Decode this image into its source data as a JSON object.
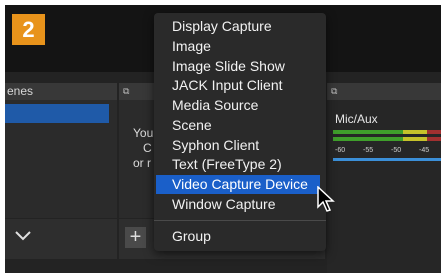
{
  "step_badge": "2",
  "scenes_panel": {
    "title": "enes",
    "footer_icon": "chevron-down-icon"
  },
  "sources_panel": {
    "dock_icon": "dock-icon",
    "message_lines": [
      "You",
      "C",
      "or r"
    ],
    "add_icon": "plus-icon"
  },
  "mixer_panel": {
    "dock_icon": "dock-icon",
    "channel_label": "Mic/Aux",
    "scale_labels": [
      "-60",
      "-55",
      "-50",
      "-45"
    ]
  },
  "context_menu": {
    "items": [
      "Display Capture",
      "Image",
      "Image Slide Show",
      "JACK Input Client",
      "Media Source",
      "Scene",
      "Syphon Client",
      "Text (FreeType 2)",
      "Video Capture Device",
      "Window Capture"
    ],
    "selected": "Video Capture Device",
    "group_label": "Group"
  },
  "colors": {
    "accent": "#e8931b",
    "selection": "#1a5fc9",
    "scene_selection": "#1f5aa8",
    "meter_green": "#3f9e2b",
    "meter_yellow": "#c6c12a",
    "meter_red": "#a13030"
  }
}
